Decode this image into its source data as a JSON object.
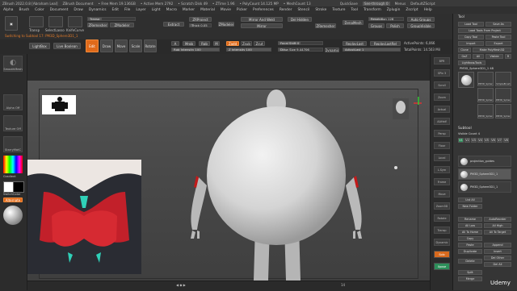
{
  "titlebar": {
    "app": "ZBrush 2022.0.8 [Abraham Leal]",
    "doc": "ZBrush Document",
    "free_mem": "• Free Mem 19.136GB",
    "active_mem": "• Active Mem 2792",
    "scratch": "• Scratch Disk 49",
    "ztime": "• ZTime 1.96",
    "polycount": "• PolyCount 14.125 MP",
    "meshcount": "• MeshCount 13",
    "quicksave": "QuickSave",
    "see_through": "See-through 0",
    "menus": "Menus",
    "script": "DefaultZScript"
  },
  "menubar": [
    "Alpha",
    "Brush",
    "Color",
    "Document",
    "Draw",
    "Dynamics",
    "Edit",
    "File",
    "Layer",
    "Light",
    "Macro",
    "Marker",
    "Material",
    "Movie",
    "Picker",
    "Preferences",
    "Render",
    "Stencil",
    "Stroke",
    "Texture",
    "Tool",
    "Transform",
    "Zplugin",
    "Zscript",
    "Help"
  ],
  "shelf": {
    "status": "Switching to Subtool 17: PM3D_Sphere3D1_1",
    "lightbox": "LightBox",
    "live_boolean": "Live Boolean",
    "subtool_name": "PM3D_Sphere3D1_1",
    "edit": "Edit",
    "draw": "Draw",
    "move": "Move",
    "scale": "Scale",
    "rotate": "Rotate",
    "a_btn": "A",
    "mrgb": "Mrgb",
    "rgb": "Rgb",
    "m": "M",
    "zadd": "Zadd",
    "zsub": "Zsub",
    "zcut": "Zcut",
    "rgb_intensity": "Rgb Intensity 100",
    "z_intensity": "Z Intensity 100",
    "focal_shift": "Focal Shift 0",
    "draw_size": "Draw Size 9.44706",
    "dynamic": "Dynamic",
    "replay_last": "ReplayLast",
    "replay_last_rel": "ReplayLastRel",
    "active_points": "ActivePoints: 6,066",
    "total_points": "TotalPoints: 14.503 Mil",
    "adjust_last": "AdjustLast 1",
    "dynamesh": "DynaMesh",
    "resolution": "Resolution 128",
    "groups": "Groups",
    "polish": "Polish",
    "auto_groups": "Auto Groups",
    "group_visible": "GroupVisible",
    "del_hidden": "Del Hidden",
    "mirror_weld": "Mirror And Weld",
    "mirror": "Mirror",
    "zremesher": "ZRemesher",
    "zmodeler": "ZModeler",
    "thick": "Thick 0.05",
    "extract": "Extract",
    "zrrojects": "ZRProject",
    "brush_slot": "Transp",
    "cut_slot": "KnifeCurve",
    "smooth_slot": "SelectLasso",
    "crystal": "Crystal_3"
  },
  "leftpanel": {
    "tool1": "SmoothMesh",
    "tool2": "Alpha Off",
    "tool3": "Texture Off",
    "material": "StarryMatC",
    "gradient": "Gradient",
    "switch_color": "SwitchColor",
    "alternate": "Alternate"
  },
  "viewport": {
    "bg_color": "#4a4a4a",
    "sphere_color": "#d9d9d9",
    "body_color": "#b9b9b9",
    "accent_red": "#c21a1a"
  },
  "rightstrip": [
    "BPR",
    "SPix 3",
    "Scroll",
    "Zoom",
    "Actual",
    "AAHalf",
    "Persp",
    "Floor",
    "Local",
    "L.Sym",
    "Frame",
    "Move",
    "Zoom3D",
    "Rotate",
    "Transp",
    "Dynamic",
    "Solo",
    "Xpose"
  ],
  "tray": {
    "header": "Tool",
    "load_tool": "Load Tool",
    "save_as": "Save As",
    "load_tools_project": "Load Tools From Project",
    "copy_tool": "Copy Tool",
    "paste_tool": "Paste Tool",
    "import": "Import",
    "export": "Export",
    "clone": "Clone",
    "make_polymesh": "Make PolyMesh3D",
    "goz": "GoZ",
    "all": "All",
    "visible": "Visible",
    "r": "R",
    "lightbox_tools": "Lightbox▸Tools",
    "current_tool": "PM3D_Sphere3D1_1 48",
    "tool_thumbs": [
      "PM3D_Sphere3D",
      "SimpleBrush",
      "PM3D_Sphere3D",
      "PM3D_Sphere3D",
      "PM3D_Sphere3D",
      "PM3D_Sphere3D"
    ],
    "subtool": "Subtool",
    "visible_count": "Visible Count 4",
    "v_tabs": [
      "V1",
      "V2",
      "V3",
      "V4",
      "V5",
      "V6",
      "V7",
      "V8"
    ],
    "subtool_items": [
      "projection_guides",
      "PM3D_Sphere3D1_1",
      "PM3D_Sphere3D1_1"
    ],
    "list_all": "List All",
    "new_folder": "New Folder",
    "rename": "Rename",
    "auto_reorder": "AutoReorder",
    "all_low": "All Low",
    "all_high": "All High",
    "all_to_home": "All To Home",
    "all_to_target": "All To Target",
    "copy": "Copy",
    "paste": "Paste",
    "duplicate": "Duplicate",
    "append": "Append",
    "insert": "Insert",
    "delete": "Delete",
    "del_other": "Del Other",
    "del_all": "Del All",
    "split": "Split",
    "merge": "Merge"
  },
  "bottombar": {
    "page_num": "14"
  },
  "watermark": "Udemy"
}
